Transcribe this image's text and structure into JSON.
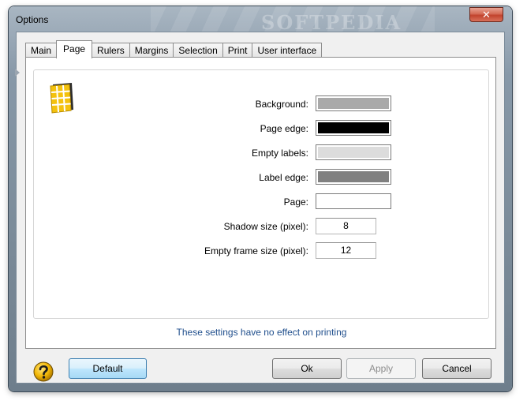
{
  "window": {
    "title": "Options",
    "watermark": "SOFTPEDIA",
    "close_label": "✕"
  },
  "tabs": [
    {
      "label": "Main"
    },
    {
      "label": "Page"
    },
    {
      "label": "Rulers"
    },
    {
      "label": "Margins"
    },
    {
      "label": "Selection"
    },
    {
      "label": "Print"
    },
    {
      "label": "User interface"
    }
  ],
  "active_tab": "Page",
  "page_settings": {
    "background": {
      "label": "Background:",
      "color": "#a9a9a9"
    },
    "page_edge": {
      "label": "Page edge:",
      "color": "#000000"
    },
    "empty_labels": {
      "label": "Empty labels:",
      "color": "#dcdcdc"
    },
    "label_edge": {
      "label": "Label edge:",
      "color": "#808080"
    },
    "page": {
      "label": "Page:",
      "color": "#ffffff"
    },
    "shadow_size": {
      "label": "Shadow size (pixel):",
      "value": "8"
    },
    "empty_frame_size": {
      "label": "Empty frame size (pixel):",
      "value": "12"
    }
  },
  "note": "These settings have no effect on printing",
  "buttons": {
    "default": "Default",
    "ok": "Ok",
    "apply": "Apply",
    "cancel": "Cancel"
  }
}
